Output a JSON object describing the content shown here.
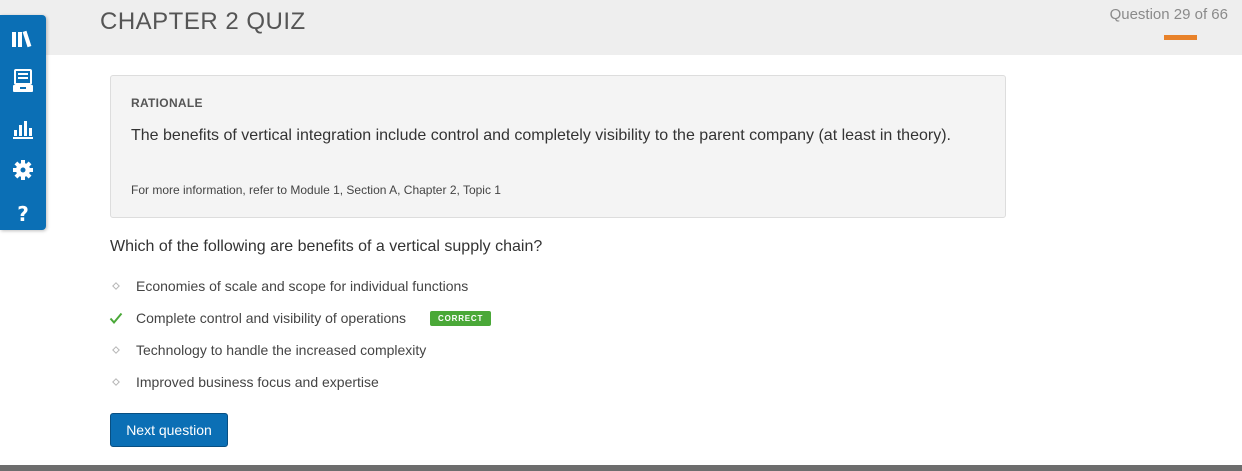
{
  "header": {
    "title": "CHAPTER 2 QUIZ",
    "counter": "Question 29 of 66",
    "progress_fraction": 0.44
  },
  "sidebar": {
    "items": [
      {
        "icon": "library-icon"
      },
      {
        "icon": "notebook-icon"
      },
      {
        "icon": "bar-chart-icon"
      },
      {
        "icon": "settings-icon"
      },
      {
        "icon": "help-icon"
      }
    ]
  },
  "rationale": {
    "label": "RATIONALE",
    "text": "The benefits of vertical integration include control and completely visibility to the parent company (at least in theory).",
    "reference": "For more information, refer to Module 1, Section A, Chapter 2, Topic 1"
  },
  "question": {
    "text": "Which of the following are benefits of a vertical supply chain?",
    "answers": [
      {
        "text": "Economies of scale and scope for individual functions",
        "correct": false
      },
      {
        "text": "Complete control and visibility of operations",
        "correct": true,
        "badge": "CORRECT"
      },
      {
        "text": "Technology to handle the increased complexity",
        "correct": false
      },
      {
        "text": "Improved business focus and expertise",
        "correct": false
      }
    ]
  },
  "actions": {
    "next_label": "Next question"
  },
  "colors": {
    "accent": "#0b6fb5",
    "progress": "#e8822a",
    "correct": "#4aa838"
  }
}
